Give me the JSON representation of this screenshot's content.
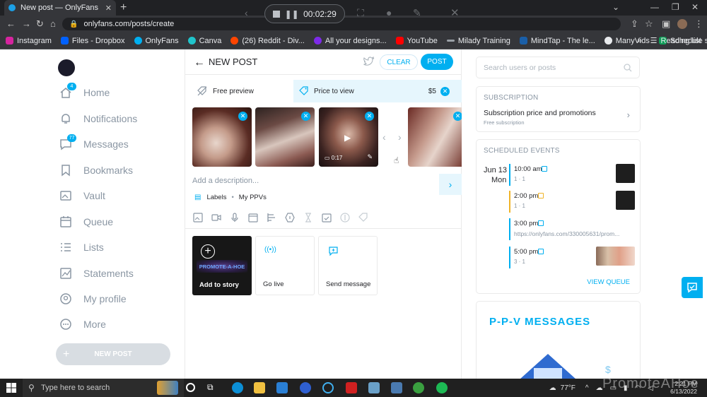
{
  "browser": {
    "tab_title": "New post — OnlyFans",
    "new_tab": "+",
    "url": "onlyfans.com/posts/create",
    "recorder_time": "00:02:29",
    "bookmarks": [
      {
        "label": "Instagram",
        "color": "#d6249f"
      },
      {
        "label": "Files - Dropbox",
        "color": "#0061ff"
      },
      {
        "label": "OnlyFans",
        "color": "#00aff0"
      },
      {
        "label": "Canva",
        "color": "#20c4cb"
      },
      {
        "label": "(26) Reddit - Div...",
        "color": "#ff4500"
      },
      {
        "label": "All your designs...",
        "color": "#7d2ae8"
      },
      {
        "label": "YouTube",
        "color": "#ff0000"
      },
      {
        "label": "Milady Training",
        "color": "#9aa0a6"
      },
      {
        "label": "MindTap - The le...",
        "color": "#1a5fa8"
      },
      {
        "label": "ManyVids",
        "color": "#e8eaed"
      },
      {
        "label": "Schedule spread...",
        "color": "#0f9d58"
      }
    ],
    "bookmarks_more": "»",
    "reading_list": "Reading list"
  },
  "sidebar": {
    "items": [
      {
        "label": "Home",
        "badge": "4"
      },
      {
        "label": "Notifications",
        "badge": ""
      },
      {
        "label": "Messages",
        "badge": "77"
      },
      {
        "label": "Bookmarks",
        "badge": ""
      },
      {
        "label": "Vault",
        "badge": ""
      },
      {
        "label": "Queue",
        "badge": ""
      },
      {
        "label": "Lists",
        "badge": ""
      },
      {
        "label": "Statements",
        "badge": ""
      },
      {
        "label": "My profile",
        "badge": ""
      },
      {
        "label": "More",
        "badge": ""
      }
    ],
    "new_post": "NEW POST"
  },
  "main": {
    "title": "NEW POST",
    "clear": "CLEAR",
    "post": "POST",
    "free_preview": "Free preview",
    "price_to_view": "Price to view",
    "price": "$5",
    "video_duration": "0:17",
    "description_placeholder": "Add a description...",
    "labels": "Labels",
    "label_value": "My PPVs",
    "cards": {
      "story": "Add to story",
      "story_logo": "PROMOTE-A-HOE",
      "live": "Go live",
      "message": "Send message"
    }
  },
  "right": {
    "search_placeholder": "Search users or posts",
    "subscription": {
      "heading": "SUBSCRIPTION",
      "title": "Subscription price and promotions",
      "subtitle": "Free subscription"
    },
    "scheduled": {
      "heading": "SCHEDULED EVENTS",
      "date": "Jun 13",
      "day": "Mon",
      "events": [
        {
          "time": "10:00 am",
          "meta": "1  ·  1",
          "color": "#00aff0"
        },
        {
          "time": "2:00 pm",
          "meta": "1  ·  1",
          "color": "#f0b429"
        },
        {
          "time": "3:00 pm",
          "url": "https://onlyfans.com/330005631/prom...",
          "color": "#00aff0"
        },
        {
          "time": "5:00 pm",
          "meta": "3  ·  1",
          "color": "#00aff0"
        }
      ],
      "view_queue": "VIEW QUEUE"
    },
    "ppv_title": "P-P-V  MESSAGES"
  },
  "taskbar": {
    "search": "Type here to search",
    "temperature": "77°F",
    "time": "2:21 PM",
    "date": "6/13/2022"
  },
  "watermark": "PromoteAHoe"
}
